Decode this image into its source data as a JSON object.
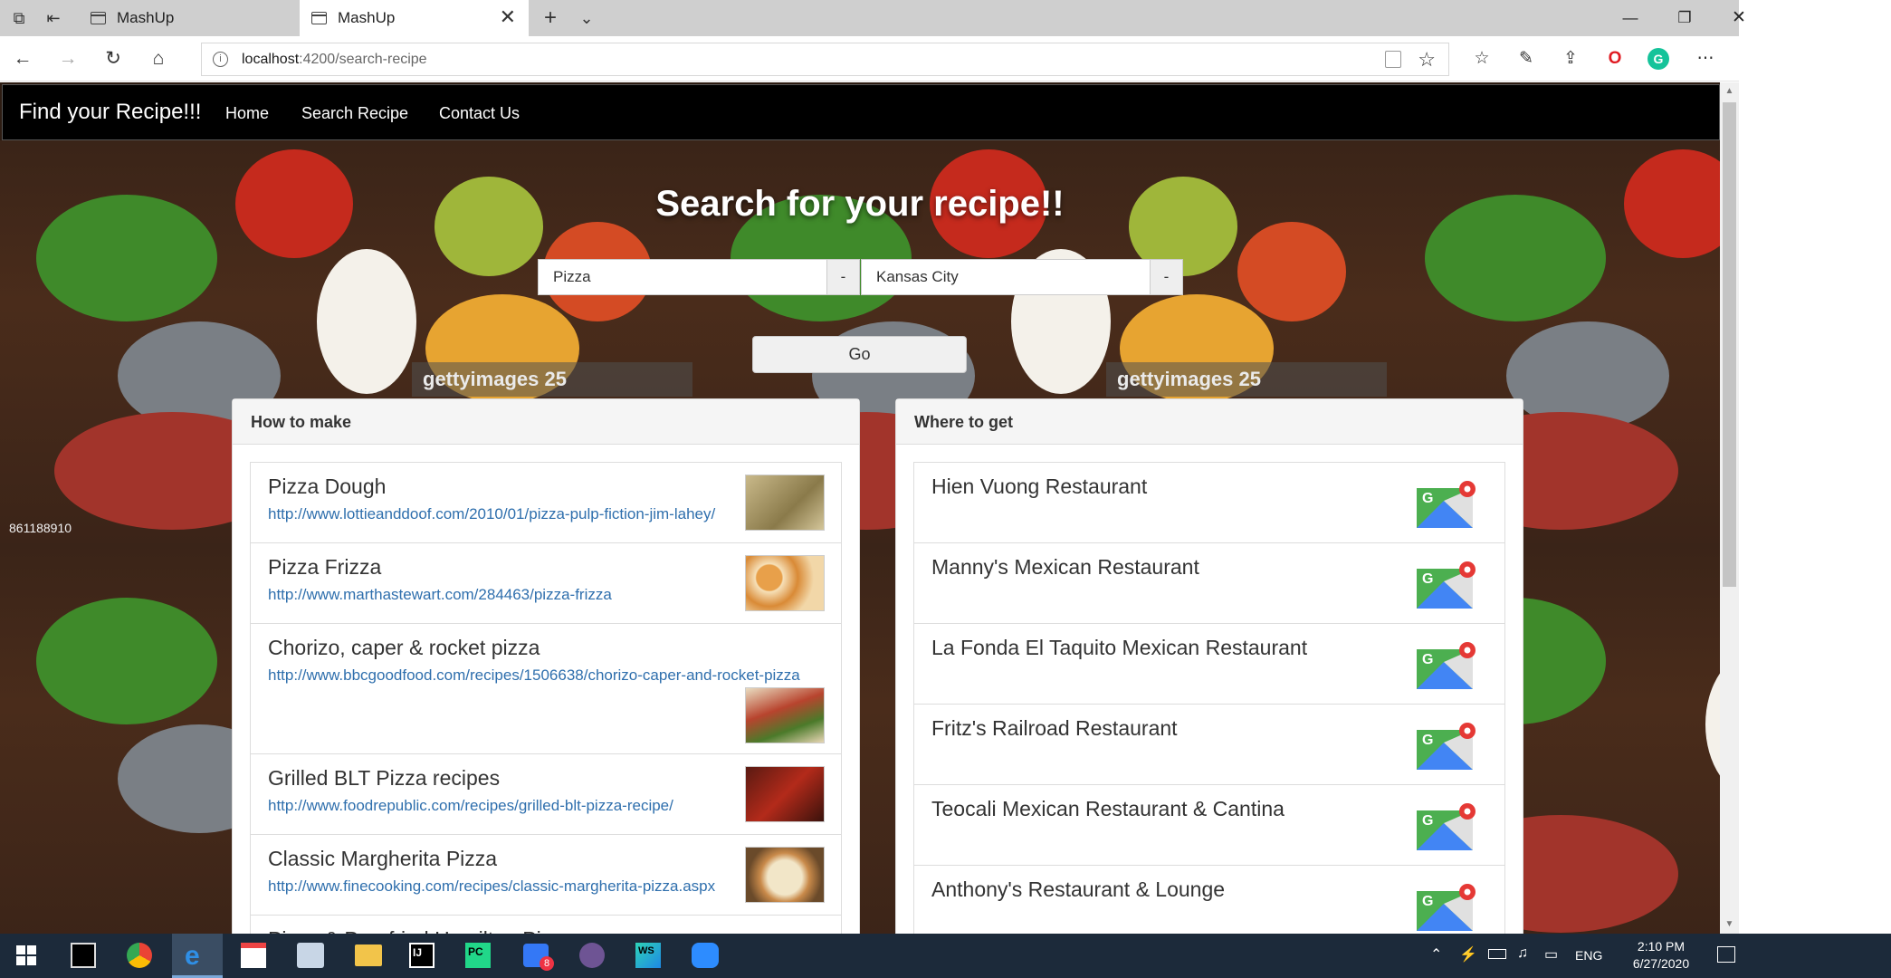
{
  "browser": {
    "tabs": [
      {
        "label": "MashUp"
      },
      {
        "label": "MashUp"
      }
    ],
    "url_host": "localhost",
    "url_rest": ":4200/search-recipe"
  },
  "navbar": {
    "brand": "Find your Recipe!!!",
    "links": [
      "Home",
      "Search Recipe",
      "Contact Us"
    ]
  },
  "hero": {
    "title": "Search for your recipe!!",
    "recipe_query": "Pizza",
    "location_query": "Kansas City",
    "addon_label": "-",
    "go_label": "Go",
    "watermark": "gettyimages",
    "watermark_years": "25",
    "image_id": "861188910"
  },
  "how_to_make": {
    "heading": "How to make",
    "items": [
      {
        "title": "Pizza Dough",
        "url": "http://www.lottieanddoof.com/2010/01/pizza-pulp-fiction-jim-lahey/"
      },
      {
        "title": "Pizza Frizza",
        "url": "http://www.marthastewart.com/284463/pizza-frizza"
      },
      {
        "title": "Chorizo, caper & rocket pizza",
        "url": "http://www.bbcgoodfood.com/recipes/1506638/chorizo-caper-and-rocket-pizza"
      },
      {
        "title": "Grilled BLT Pizza recipes",
        "url": "http://www.foodrepublic.com/recipes/grilled-blt-pizza-recipe/"
      },
      {
        "title": "Classic Margherita Pizza",
        "url": "http://www.finecooking.com/recipes/classic-margherita-pizza.aspx"
      },
      {
        "title": "Pizza & Pan-fried Hamilton Pie",
        "url": ""
      }
    ]
  },
  "where_to_get": {
    "heading": "Where to get",
    "items": [
      {
        "name": "Hien Vuong Restaurant"
      },
      {
        "name": "Manny's Mexican Restaurant"
      },
      {
        "name": "La Fonda El Taquito Mexican Restaurant"
      },
      {
        "name": "Fritz's Railroad Restaurant"
      },
      {
        "name": "Teocali Mexican Restaurant & Cantina"
      },
      {
        "name": "Anthony's Restaurant & Lounge"
      }
    ]
  },
  "taskbar": {
    "time": "2:10 PM",
    "date": "6/27/2020",
    "lang": "ENG",
    "mail_badge": "8"
  }
}
